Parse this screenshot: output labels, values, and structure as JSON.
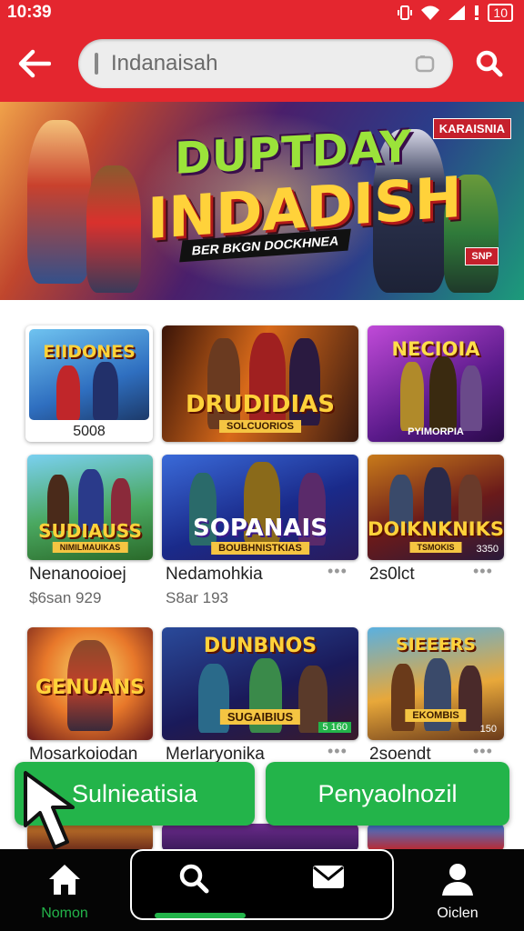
{
  "status_bar": {
    "time": "10:39",
    "battery": "10"
  },
  "header": {
    "search_placeholder": "Indanaisah"
  },
  "banner": {
    "title_top": "DUPTDAY",
    "title_main": "INDADISH",
    "ribbon": "BER BKGN DOCKHNEA",
    "badge": "KARAISNIA",
    "corner": "SNP"
  },
  "row1": [
    {
      "title": "EIIDONES",
      "caption": "5008"
    },
    {
      "title": "DRUDIDIAS",
      "strip": "SOLCUORIOS"
    },
    {
      "title": "NECIOIA",
      "strip": "PYIMORPIA"
    }
  ],
  "row2": [
    {
      "title": "SUDIAUSS",
      "strip": "NIMILMAUIKAS",
      "label": "Nenanooioej",
      "sub": "$6san 929"
    },
    {
      "title": "SOPANAIS",
      "strip": "BOUBHNISTKIAS",
      "label": "Nedamohkia",
      "sub": "S8ar 193"
    },
    {
      "title": "DOIKNKNIKS",
      "strip": "TSMOKIS",
      "tag": "3350",
      "label": "2s0lct"
    }
  ],
  "row3": [
    {
      "title": "GENUANS",
      "label": "Mosarkoiodan"
    },
    {
      "title": "DUNBNOS",
      "strip": "SUGAIBIUS",
      "tag": "5 160",
      "label": "Merlaryonika"
    },
    {
      "title": "SIEEERS",
      "strip": "EKOMBIS",
      "tag": "150",
      "label": "2soendt"
    }
  ],
  "buttons": {
    "left": "Sulnieatisia",
    "right": "Penyaolnozil"
  },
  "bottom_nav": {
    "home": "Nomon",
    "profile": "Oiclen"
  },
  "colors": {
    "brand_red": "#e4262f",
    "action_green": "#23b44a",
    "nav_bg": "#050505"
  }
}
